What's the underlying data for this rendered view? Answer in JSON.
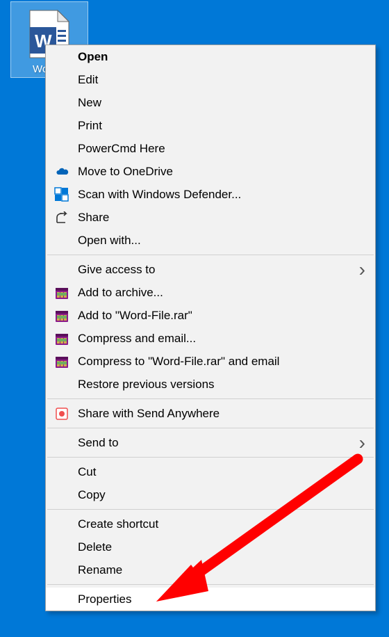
{
  "desktop": {
    "icon_label": "Word..."
  },
  "context_menu": {
    "sections": [
      [
        {
          "id": "open",
          "label": "Open",
          "bold": true,
          "icon": null,
          "submenu": false
        },
        {
          "id": "edit",
          "label": "Edit",
          "bold": false,
          "icon": null,
          "submenu": false
        },
        {
          "id": "new",
          "label": "New",
          "bold": false,
          "icon": null,
          "submenu": false
        },
        {
          "id": "print",
          "label": "Print",
          "bold": false,
          "icon": null,
          "submenu": false
        },
        {
          "id": "powercmd",
          "label": "PowerCmd Here",
          "bold": false,
          "icon": null,
          "submenu": false
        },
        {
          "id": "onedrive",
          "label": "Move to OneDrive",
          "bold": false,
          "icon": "onedrive",
          "submenu": false
        },
        {
          "id": "defender",
          "label": "Scan with Windows Defender...",
          "bold": false,
          "icon": "defender",
          "submenu": false
        },
        {
          "id": "share",
          "label": "Share",
          "bold": false,
          "icon": "share",
          "submenu": false
        },
        {
          "id": "openwith",
          "label": "Open with...",
          "bold": false,
          "icon": null,
          "submenu": false
        }
      ],
      [
        {
          "id": "giveaccess",
          "label": "Give access to",
          "bold": false,
          "icon": null,
          "submenu": true
        },
        {
          "id": "addarchive",
          "label": "Add to archive...",
          "bold": false,
          "icon": "winrar",
          "submenu": false
        },
        {
          "id": "addrar",
          "label": "Add to \"Word-File.rar\"",
          "bold": false,
          "icon": "winrar",
          "submenu": false
        },
        {
          "id": "compressemail",
          "label": "Compress and email...",
          "bold": false,
          "icon": "winrar",
          "submenu": false
        },
        {
          "id": "compressraremail",
          "label": "Compress to \"Word-File.rar\" and email",
          "bold": false,
          "icon": "winrar",
          "submenu": false
        },
        {
          "id": "restoreprev",
          "label": "Restore previous versions",
          "bold": false,
          "icon": null,
          "submenu": false
        }
      ],
      [
        {
          "id": "sendanywhere",
          "label": "Share with Send Anywhere",
          "bold": false,
          "icon": "sendanywhere",
          "submenu": false
        }
      ],
      [
        {
          "id": "sendto",
          "label": "Send to",
          "bold": false,
          "icon": null,
          "submenu": true
        }
      ],
      [
        {
          "id": "cut",
          "label": "Cut",
          "bold": false,
          "icon": null,
          "submenu": false
        },
        {
          "id": "copy",
          "label": "Copy",
          "bold": false,
          "icon": null,
          "submenu": false
        }
      ],
      [
        {
          "id": "createshortcut",
          "label": "Create shortcut",
          "bold": false,
          "icon": null,
          "submenu": false
        },
        {
          "id": "delete",
          "label": "Delete",
          "bold": false,
          "icon": null,
          "submenu": false
        },
        {
          "id": "rename",
          "label": "Rename",
          "bold": false,
          "icon": null,
          "submenu": false
        }
      ],
      [
        {
          "id": "properties",
          "label": "Properties",
          "bold": false,
          "icon": null,
          "submenu": false,
          "hovered": true
        }
      ]
    ]
  }
}
